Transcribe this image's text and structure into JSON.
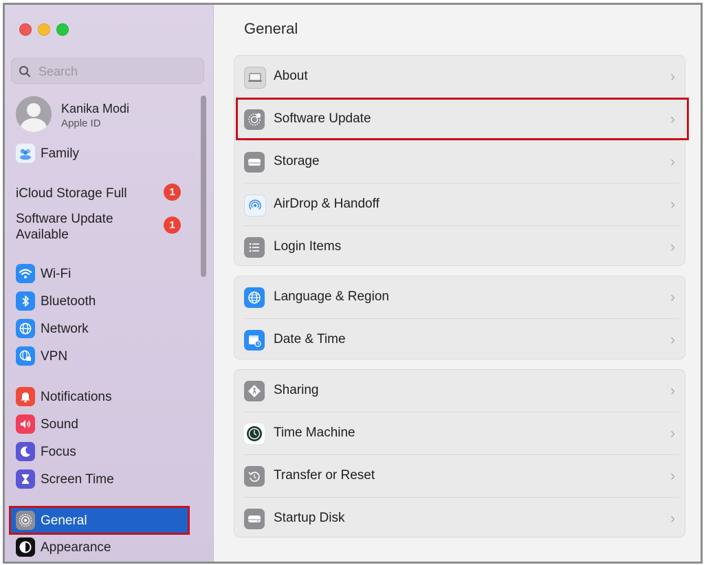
{
  "search": {
    "placeholder": "Search"
  },
  "user": {
    "name": "Kanika Modi",
    "subtitle": "Apple ID"
  },
  "family": {
    "label": "Family"
  },
  "alerts": [
    {
      "label": "iCloud Storage Full",
      "badge": "1"
    },
    {
      "label": "Software Update\nAvailable",
      "badge": "1"
    }
  ],
  "sidebar": {
    "items": [
      {
        "label": "Wi-Fi",
        "icon": "wifi-icon",
        "color": "#2c8cf3"
      },
      {
        "label": "Bluetooth",
        "icon": "bluetooth-icon",
        "color": "#2c8cf3"
      },
      {
        "label": "Network",
        "icon": "globe-icon",
        "color": "#2c8cf3"
      },
      {
        "label": "VPN",
        "icon": "vpn-icon",
        "color": "#2c8cf3"
      },
      {
        "label": "Notifications",
        "icon": "bell-icon",
        "color": "#ef4b3b"
      },
      {
        "label": "Sound",
        "icon": "speaker-icon",
        "color": "#ef3f5a"
      },
      {
        "label": "Focus",
        "icon": "moon-icon",
        "color": "#5b56d6"
      },
      {
        "label": "Screen Time",
        "icon": "hourglass-icon",
        "color": "#5b56d6"
      },
      {
        "label": "General",
        "icon": "gear-icon",
        "color": "#8e8e93"
      },
      {
        "label": "Appearance",
        "icon": "appearance-icon",
        "color": "#111111"
      }
    ]
  },
  "main": {
    "title": "General",
    "groups": [
      [
        {
          "label": "About",
          "icon": "laptop-icon"
        },
        {
          "label": "Software Update",
          "icon": "gear-badge-icon"
        },
        {
          "label": "Storage",
          "icon": "drive-icon"
        },
        {
          "label": "AirDrop & Handoff",
          "icon": "airdrop-icon"
        },
        {
          "label": "Login Items",
          "icon": "list-icon"
        }
      ],
      [
        {
          "label": "Language & Region",
          "icon": "globe-icon"
        },
        {
          "label": "Date & Time",
          "icon": "calendar-clock-icon"
        }
      ],
      [
        {
          "label": "Sharing",
          "icon": "sharing-icon"
        },
        {
          "label": "Time Machine",
          "icon": "time-machine-icon"
        },
        {
          "label": "Transfer or Reset",
          "icon": "reset-icon"
        },
        {
          "label": "Startup Disk",
          "icon": "disk-icon"
        }
      ]
    ],
    "chevron": "›"
  }
}
